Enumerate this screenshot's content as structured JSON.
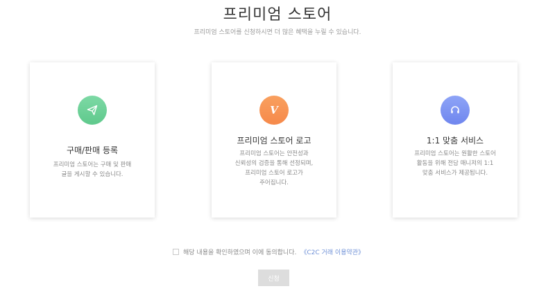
{
  "header": {
    "title": "프리미엄 스토어",
    "subtitle": "프리미엄 스토어를 신청하시면 더 많은 혜택을 누릴 수 있습니다."
  },
  "cards": [
    {
      "icon": "paper-plane-icon",
      "color": "#6fd198",
      "title": "구매/판매 등록",
      "description": "프리미엄 스토어는 구매 및 판매 글을 게시할 수 있습니다."
    },
    {
      "icon": "v-logo-icon",
      "icon_text": "V",
      "color": "#f7914f",
      "title": "프리미엄 스토어 로고",
      "description": "프리미엄 스토어는 안전성과 신뢰성의 검증을 통해 선정되며, 프리미엄 스토어 로고가 주어집니다."
    },
    {
      "icon": "headset-icon",
      "color": "#7b92f2",
      "title": "1:1 맞춤 서비스",
      "description": "프리미엄 스토어는 원활한 스토어 활동을 위해 전담 매니저의 1:1 맞춤 서비스가 제공됩니다."
    }
  ],
  "agreement": {
    "checked": false,
    "text": "해당 내용을 확인하였으며 이에 동의합니다.",
    "link_text": "《C2C 거래 이용약관》",
    "link_color": "#6d8fd6"
  },
  "apply_button": {
    "label": "신청",
    "color": "#dddddd"
  }
}
